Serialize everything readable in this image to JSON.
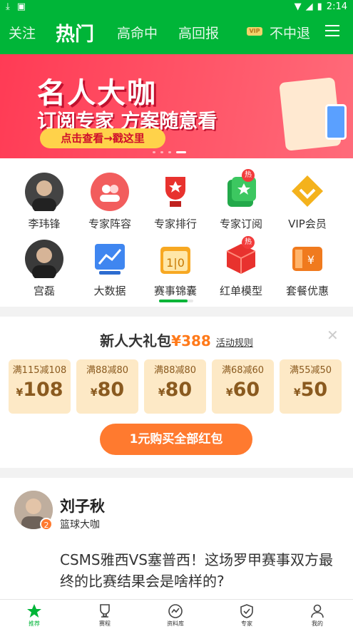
{
  "status": {
    "time": "2:14"
  },
  "header": {
    "tabs": [
      {
        "label": "关注"
      },
      {
        "label": "热门"
      },
      {
        "label": "高命中"
      },
      {
        "label": "高回报"
      },
      {
        "label": "不中退"
      }
    ],
    "vip_badge": "VIP"
  },
  "banner": {
    "title": "名人大咖",
    "subtitle": "订阅专家 方案随意看",
    "button": "点击查看→戳这里"
  },
  "grid": [
    {
      "label": "李玮锋",
      "icon": "expert-avatar"
    },
    {
      "label": "专家阵容",
      "icon": "team-icon"
    },
    {
      "label": "专家排行",
      "icon": "trophy-icon"
    },
    {
      "label": "专家订阅",
      "icon": "subscribe-icon",
      "hot": "热"
    },
    {
      "label": "VIP会员",
      "icon": "vip-icon"
    },
    {
      "label": "宫磊",
      "icon": "expert-avatar"
    },
    {
      "label": "大数据",
      "icon": "chart-icon"
    },
    {
      "label": "赛事锦囊",
      "icon": "calendar-icon"
    },
    {
      "label": "红单模型",
      "icon": "cube-icon",
      "hot": "热"
    },
    {
      "label": "套餐优惠",
      "icon": "ticket-icon"
    }
  ],
  "gift": {
    "title": "新人大礼包",
    "amount": "¥388",
    "rule": "活动规则",
    "coupons": [
      {
        "cond": "满115减108",
        "value": "108"
      },
      {
        "cond": "满88减80",
        "value": "80"
      },
      {
        "cond": "满88减80",
        "value": "80"
      },
      {
        "cond": "满68减60",
        "value": "60"
      },
      {
        "cond": "满55减50",
        "value": "50"
      }
    ],
    "currency": "¥",
    "buy_button": "1元购买全部红包"
  },
  "card": {
    "name": "刘子秋",
    "role": "篮球大咖",
    "badge": "2",
    "headline": "CSMS雅西VS塞普西！这场罗甲赛事双方最终的比赛结果会是啥样的?"
  },
  "nav": [
    {
      "label": "推荐",
      "icon": "star-icon",
      "active": true
    },
    {
      "label": "赛程",
      "icon": "cup-icon"
    },
    {
      "label": "资料库",
      "icon": "trend-icon"
    },
    {
      "label": "专家",
      "icon": "shield-icon"
    },
    {
      "label": "我的",
      "icon": "user-icon"
    }
  ],
  "colors": {
    "brand": "#00b538",
    "accent": "#ff7a2f",
    "banner": "#ff3b55"
  }
}
